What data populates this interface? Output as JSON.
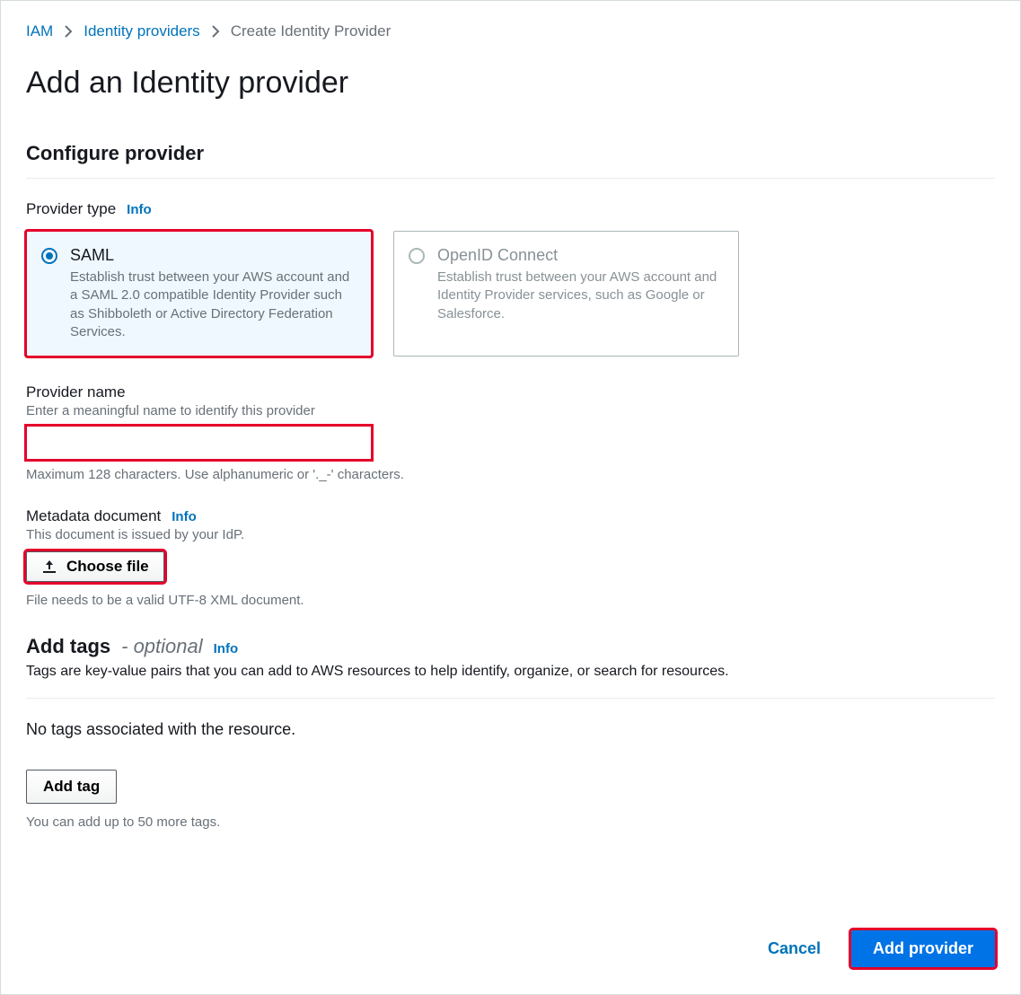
{
  "breadcrumb": {
    "item1": "IAM",
    "item2": "Identity providers",
    "item3": "Create Identity Provider"
  },
  "page_title": "Add an Identity provider",
  "configure_section_title": "Configure provider",
  "provider_type": {
    "label": "Provider type",
    "info": "Info",
    "options": [
      {
        "title": "SAML",
        "desc": "Establish trust between your AWS account and a SAML 2.0 compatible Identity Provider such as Shibboleth or Active Directory Federation Services.",
        "selected": true
      },
      {
        "title": "OpenID Connect",
        "desc": "Establish trust between your AWS account and Identity Provider services, such as Google or Salesforce.",
        "selected": false
      }
    ]
  },
  "provider_name": {
    "label": "Provider name",
    "help": "Enter a meaningful name to identify this provider",
    "value": "",
    "constraint": "Maximum 128 characters. Use alphanumeric or '._-' characters."
  },
  "metadata": {
    "label": "Metadata document",
    "info": "Info",
    "help": "This document is issued by your IdP.",
    "button": "Choose file",
    "constraint": "File needs to be a valid UTF-8 XML document."
  },
  "tags": {
    "heading": "Add tags",
    "optional_suffix": "- optional",
    "info": "Info",
    "desc": "Tags are key-value pairs that you can add to AWS resources to help identify, organize, or search for resources.",
    "empty_text": "No tags associated with the resource.",
    "add_button": "Add tag",
    "limit_text": "You can add up to 50 more tags."
  },
  "footer": {
    "cancel": "Cancel",
    "submit": "Add provider"
  }
}
